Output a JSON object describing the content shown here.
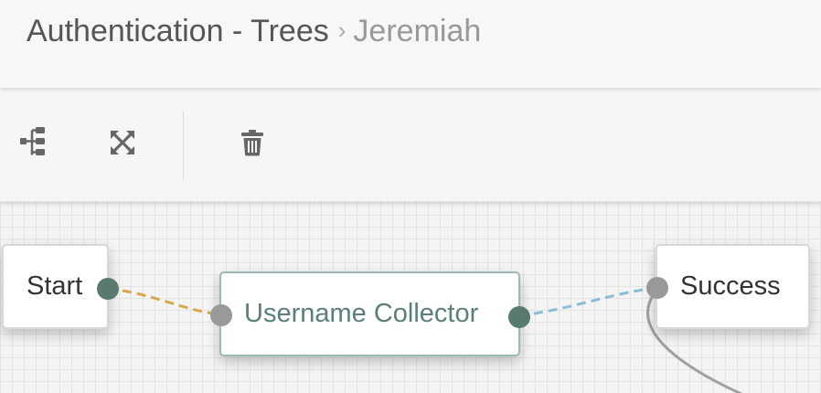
{
  "header": {
    "breadcrumb_parent": "Authentication - Trees",
    "breadcrumb_separator": "›",
    "breadcrumb_current": "Jeremiah"
  },
  "toolbar": {
    "buttons": [
      {
        "icon": "tree-layout-icon"
      },
      {
        "icon": "expand-fullscreen-icon"
      },
      {
        "icon": "trash-icon"
      }
    ]
  },
  "canvas": {
    "nodes": [
      {
        "label": "Start"
      },
      {
        "label": "Username Collector",
        "selected": true
      },
      {
        "label": "Success"
      }
    ],
    "colors": {
      "link_start": "#d8a84f",
      "link_outcome": "#8bbcd6",
      "link_other": "#a0a0a0",
      "port_out": "#587a6f",
      "port_in": "#999999",
      "selected_text": "#5a7f78",
      "selected_border": "#9db8b3"
    }
  }
}
